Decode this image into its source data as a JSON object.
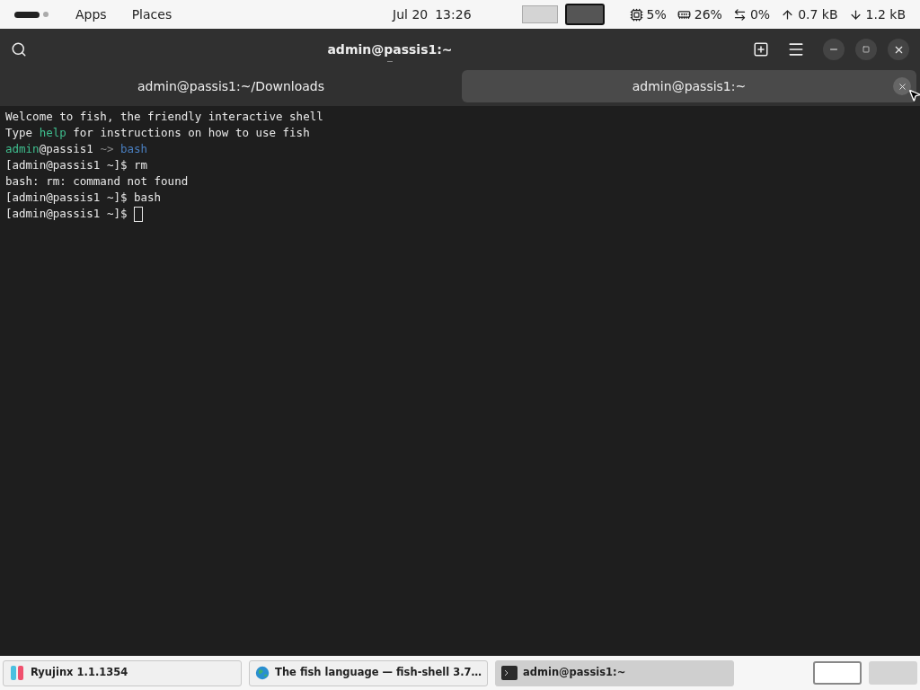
{
  "top_panel": {
    "menus": [
      "Apps",
      "Places"
    ],
    "date": "Jul 20",
    "time": "13:26",
    "workspaces": [
      {
        "selected": false
      },
      {
        "selected": true
      }
    ],
    "indicators": [
      {
        "kind": "cpu",
        "text": "5%"
      },
      {
        "kind": "memory",
        "text": "26%"
      },
      {
        "kind": "swap",
        "text": "0%"
      },
      {
        "kind": "upload",
        "text": "0.7 kB"
      },
      {
        "kind": "download",
        "text": "1.2 kB"
      }
    ]
  },
  "window": {
    "title": "admin@passis1:~"
  },
  "tabs": [
    {
      "label": "admin@passis1:~/Downloads",
      "selected": false
    },
    {
      "label": "admin@passis1:~",
      "selected": true
    }
  ],
  "terminal": {
    "lines": [
      [
        {
          "kind": "plain",
          "text": "Welcome to fish, the friendly interactive shell"
        }
      ],
      [
        {
          "kind": "plain",
          "text": "Type "
        },
        {
          "kind": "keyword",
          "text": "help"
        },
        {
          "kind": "plain",
          "text": " for instructions on how to use fish"
        }
      ],
      [
        {
          "kind": "user",
          "text": "admin"
        },
        {
          "kind": "plain",
          "text": "@passis1 "
        },
        {
          "kind": "arrow",
          "text": "~>"
        },
        {
          "kind": "command",
          "text": " bash"
        }
      ],
      [
        {
          "kind": "plain",
          "text": "[admin@passis1 ~]$ rm"
        }
      ],
      [
        {
          "kind": "plain",
          "text": "bash: rm: command not found"
        }
      ],
      [
        {
          "kind": "plain",
          "text": "[admin@passis1 ~]$ bash"
        }
      ],
      [
        {
          "kind": "plain",
          "text": "[admin@passis1 ~]$ "
        }
      ]
    ],
    "cursor": true
  },
  "taskbar": {
    "items": [
      {
        "kind": "game",
        "label": "Ryujinx 1.1.1354",
        "selected": false
      },
      {
        "kind": "browser",
        "label": "The fish language — fish-shell 3.7…",
        "selected": false
      },
      {
        "kind": "terminal",
        "label": "admin@passis1:~",
        "selected": true
      }
    ],
    "workspaces": [
      {
        "selected": true
      },
      {
        "selected": false
      }
    ]
  }
}
